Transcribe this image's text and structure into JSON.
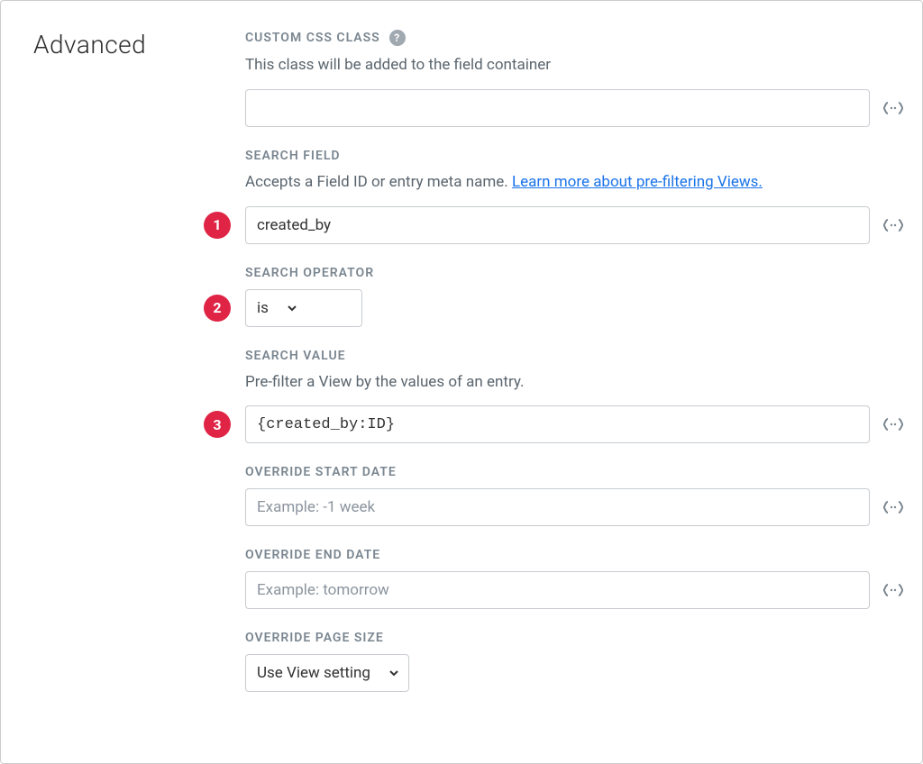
{
  "section_title": "Advanced",
  "fields": {
    "custom_css": {
      "label": "CUSTOM CSS CLASS",
      "desc": "This class will be added to the field container",
      "value": ""
    },
    "search_field": {
      "label": "SEARCH FIELD",
      "desc_prefix": "Accepts a Field ID or entry meta name. ",
      "link_text": "Learn more about pre-filtering Views.",
      "value": "created_by",
      "badge": "1"
    },
    "search_operator": {
      "label": "SEARCH OPERATOR",
      "value": "is",
      "badge": "2"
    },
    "search_value": {
      "label": "SEARCH VALUE",
      "desc": "Pre-filter a View by the values of an entry.",
      "value": "{created_by:ID}",
      "badge": "3"
    },
    "override_start": {
      "label": "OVERRIDE START DATE",
      "placeholder": "Example: -1 week",
      "value": ""
    },
    "override_end": {
      "label": "OVERRIDE END DATE",
      "placeholder": "Example: tomorrow",
      "value": ""
    },
    "override_page": {
      "label": "OVERRIDE PAGE SIZE",
      "value": "Use View setting"
    }
  }
}
